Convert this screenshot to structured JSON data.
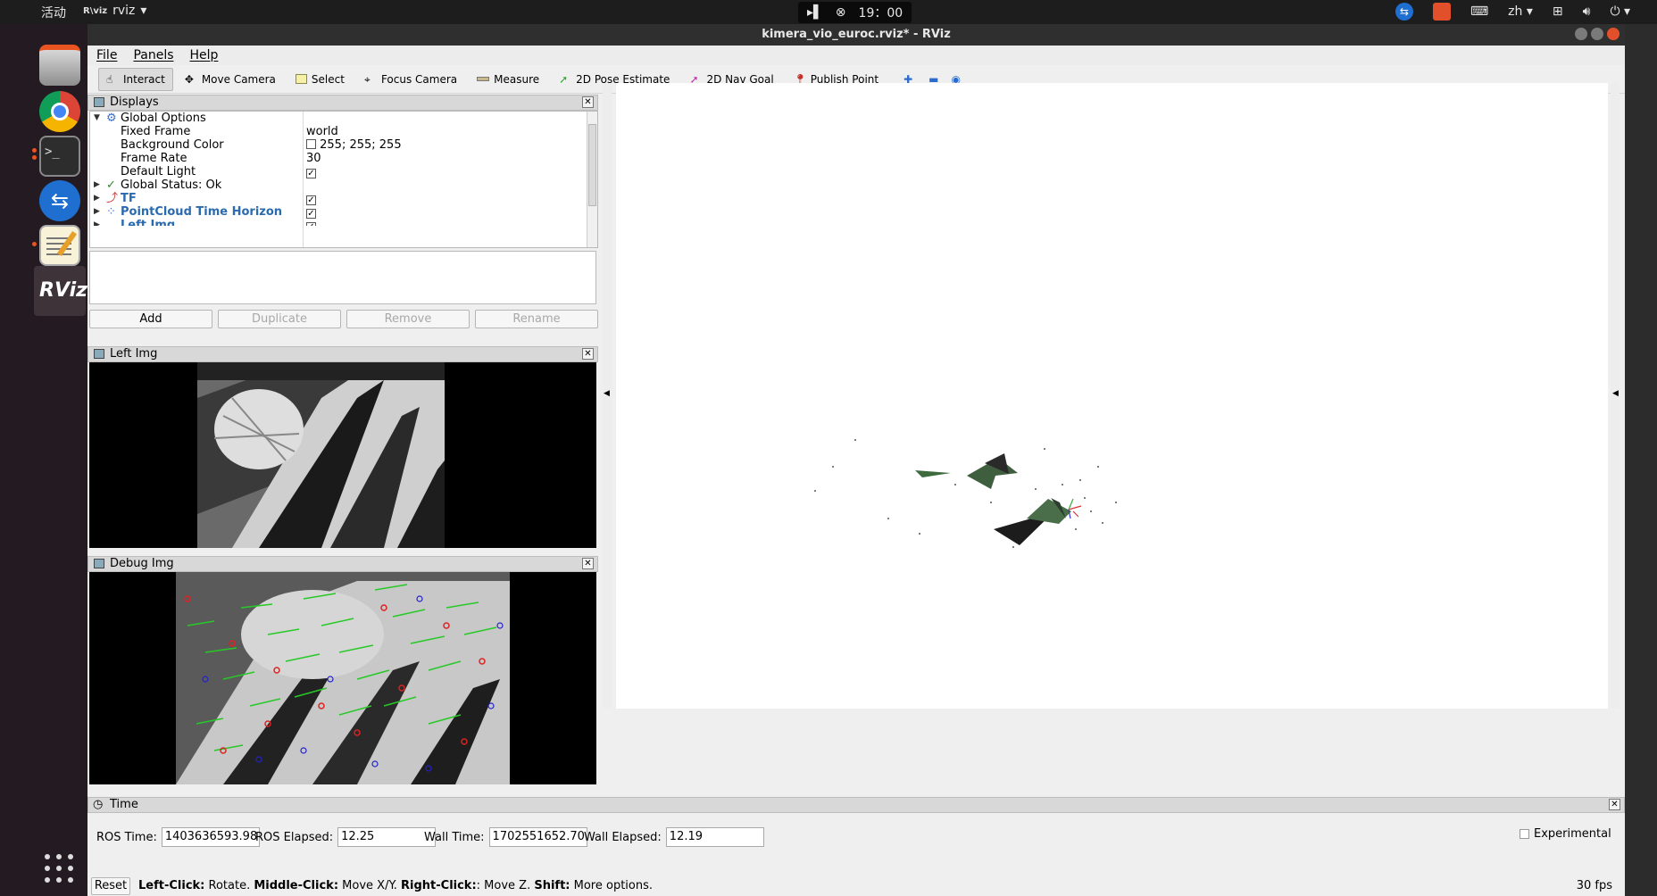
{
  "topbar": {
    "activities": "活动",
    "app_name": "rviz",
    "app_icon_text": "R\\viz",
    "time": "19：00",
    "lang": "zh"
  },
  "window": {
    "title": "kimera_vio_euroc.rviz* - RViz"
  },
  "menu": {
    "file": "File",
    "panels": "Panels",
    "help": "Help"
  },
  "toolbar": {
    "interact": "Interact",
    "move_camera": "Move Camera",
    "select": "Select",
    "focus_camera": "Focus Camera",
    "measure": "Measure",
    "pose_estimate": "2D Pose Estimate",
    "nav_goal": "2D Nav Goal",
    "publish_point": "Publish Point"
  },
  "displays": {
    "title": "Displays",
    "rows": [
      {
        "name": "Global Options",
        "value": ""
      },
      {
        "name": "Fixed Frame",
        "value": "world"
      },
      {
        "name": "Background Color",
        "value": "255; 255; 255"
      },
      {
        "name": "Frame Rate",
        "value": "30"
      },
      {
        "name": "Default Light",
        "value": "✓"
      },
      {
        "name": "Global Status: Ok",
        "value": ""
      },
      {
        "name": "TF",
        "value": "✓"
      },
      {
        "name": "PointCloud Time Horizon",
        "value": "✓"
      },
      {
        "name": "Left Img",
        "value": "✓"
      }
    ],
    "buttons": {
      "add": "Add",
      "duplicate": "Duplicate",
      "remove": "Remove",
      "rename": "Rename"
    }
  },
  "panels": {
    "left_img": "Left Img",
    "debug_img": "Debug Img"
  },
  "time_panel": {
    "title": "Time",
    "ros_time_label": "ROS Time:",
    "ros_time": "1403636593.98",
    "ros_elapsed_label": "ROS Elapsed:",
    "ros_elapsed": "12.25",
    "wall_time_label": "Wall Time:",
    "wall_time": "1702551652.70",
    "wall_elapsed_label": "Wall Elapsed:",
    "wall_elapsed": "12.19",
    "experimental": "Experimental"
  },
  "status": {
    "reset": "Reset",
    "left_click": "Left-Click:",
    "left_click_text": " Rotate. ",
    "middle_click": "Middle-Click:",
    "middle_click_text": " Move X/Y. ",
    "right_click": "Right-Click:",
    "right_click_text": ": Move Z. ",
    "shift": "Shift:",
    "shift_text": " More options.",
    "fps": "30 fps"
  },
  "colors": {
    "ubuntu_orange": "#e95420",
    "tree_blue": "#2a6bb0",
    "check_green": "#2a8a2a"
  }
}
